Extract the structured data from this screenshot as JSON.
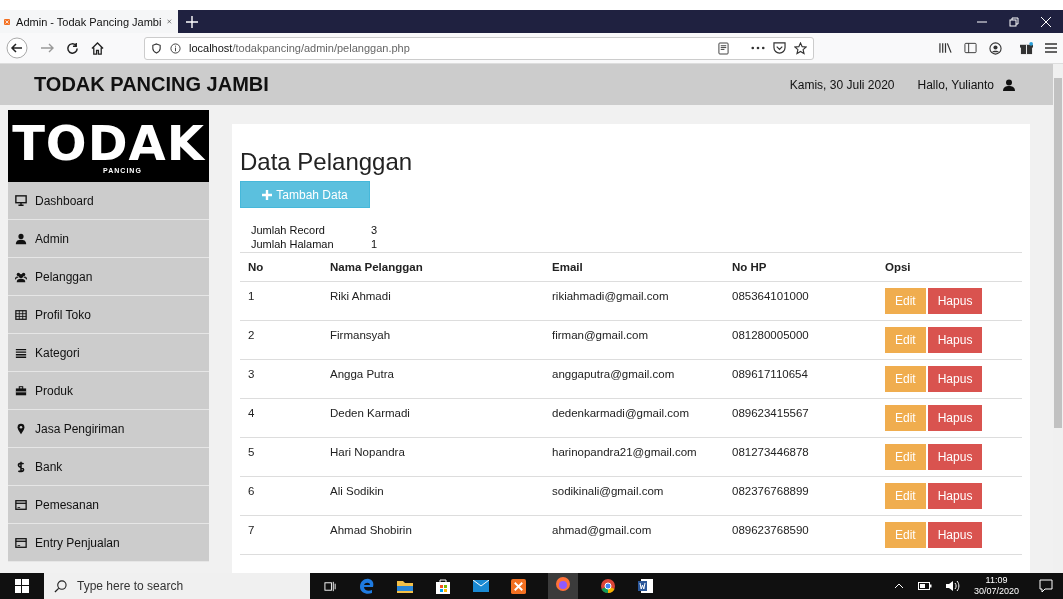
{
  "browser": {
    "tab_title": "Admin - Todak Pancing Jambi",
    "url_host": "localhost",
    "url_path": "/todakpancing/admin/pelanggan.php"
  },
  "header": {
    "brand": "TODAK PANCING JAMBI",
    "date": "Kamis, 30 Juli 2020",
    "greeting": "Hallo, Yulianto"
  },
  "logo": {
    "word": "TODAK",
    "sub": "PANCING"
  },
  "sidebar": {
    "items": [
      {
        "kind": "monitor",
        "label": "Dashboard"
      },
      {
        "kind": "user",
        "label": "Admin"
      },
      {
        "kind": "users",
        "label": "Pelanggan"
      },
      {
        "kind": "grid",
        "label": "Profil Toko"
      },
      {
        "kind": "list",
        "label": "Kategori"
      },
      {
        "kind": "briefcase",
        "label": "Produk"
      },
      {
        "kind": "pin",
        "label": "Jasa Pengiriman"
      },
      {
        "kind": "dollar",
        "label": "Bank"
      },
      {
        "kind": "card",
        "label": "Pemesanan"
      },
      {
        "kind": "card",
        "label": "Entry Penjualan"
      }
    ]
  },
  "content": {
    "title": "Data Pelanggan",
    "add_button": "Tambah Data",
    "summary": [
      {
        "label": "Jumlah Record",
        "value": "3"
      },
      {
        "label": "Jumlah Halaman",
        "value": "1"
      }
    ],
    "table": {
      "columns": [
        "No",
        "Nama Pelanggan",
        "Email",
        "No HP",
        "Opsi"
      ],
      "rows": [
        {
          "no": "1",
          "name": "Riki Ahmadi",
          "email": "rikiahmadi@gmail.com",
          "phone": "085364101000",
          "edit": "Edit",
          "delete": "Hapus"
        },
        {
          "no": "2",
          "name": "Firmansyah",
          "email": "firman@gmail.com",
          "phone": "081280005000",
          "edit": "Edit",
          "delete": "Hapus"
        },
        {
          "no": "3",
          "name": "Angga Putra",
          "email": "anggaputra@gmail.com",
          "phone": "089617110654",
          "edit": "Edit",
          "delete": "Hapus"
        },
        {
          "no": "4",
          "name": "Deden Karmadi",
          "email": "dedenkarmadi@gmail.com",
          "phone": "089623415567",
          "edit": "Edit",
          "delete": "Hapus"
        },
        {
          "no": "5",
          "name": "Hari Nopandra",
          "email": "harinopandra21@gmail.com",
          "phone": "081273446878",
          "edit": "Edit",
          "delete": "Hapus"
        },
        {
          "no": "6",
          "name": "Ali Sodikin",
          "email": "sodikinali@gmail.com",
          "phone": "082376768899",
          "edit": "Edit",
          "delete": "Hapus"
        },
        {
          "no": "7",
          "name": "Ahmad Shobirin",
          "email": "ahmad@gmail.com",
          "phone": "089623768590",
          "edit": "Edit",
          "delete": "Hapus"
        }
      ]
    }
  },
  "taskbar": {
    "search_placeholder": "Type here to search",
    "time": "11:09",
    "date": "30/07/2020"
  }
}
